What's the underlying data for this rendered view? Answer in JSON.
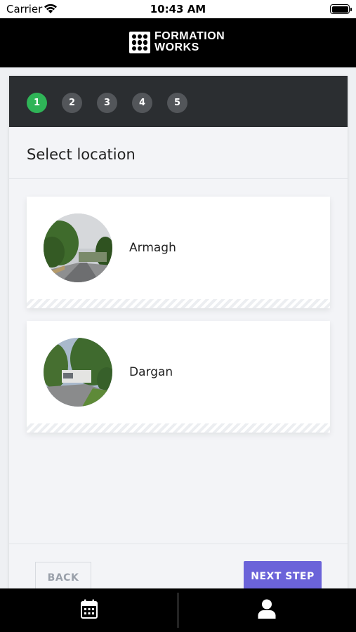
{
  "status_bar": {
    "carrier": "Carrier",
    "time": "10:43 AM",
    "icons": [
      "wifi-icon",
      "battery-icon"
    ]
  },
  "header": {
    "logo_line1": "FORMATION",
    "logo_line2": "WORKS",
    "logo_icon": "grid-dots-logo"
  },
  "stepper": {
    "steps": [
      "1",
      "2",
      "3",
      "4",
      "5"
    ],
    "active_step": "1",
    "active_color": "#2fb457",
    "inactive_color": "#53565a"
  },
  "page": {
    "title": "Select location"
  },
  "locations": [
    {
      "name": "Armagh",
      "image": "road-with-trees-photo"
    },
    {
      "name": "Dargan",
      "image": "trees-and-vehicle-photo"
    }
  ],
  "footer": {
    "back_label": "BACK",
    "next_label": "NEXT STEP",
    "accent_color": "#6b63d9"
  },
  "tabbar": {
    "tabs": [
      {
        "name": "calendar",
        "icon": "calendar-icon"
      },
      {
        "name": "profile",
        "icon": "user-icon"
      }
    ]
  }
}
